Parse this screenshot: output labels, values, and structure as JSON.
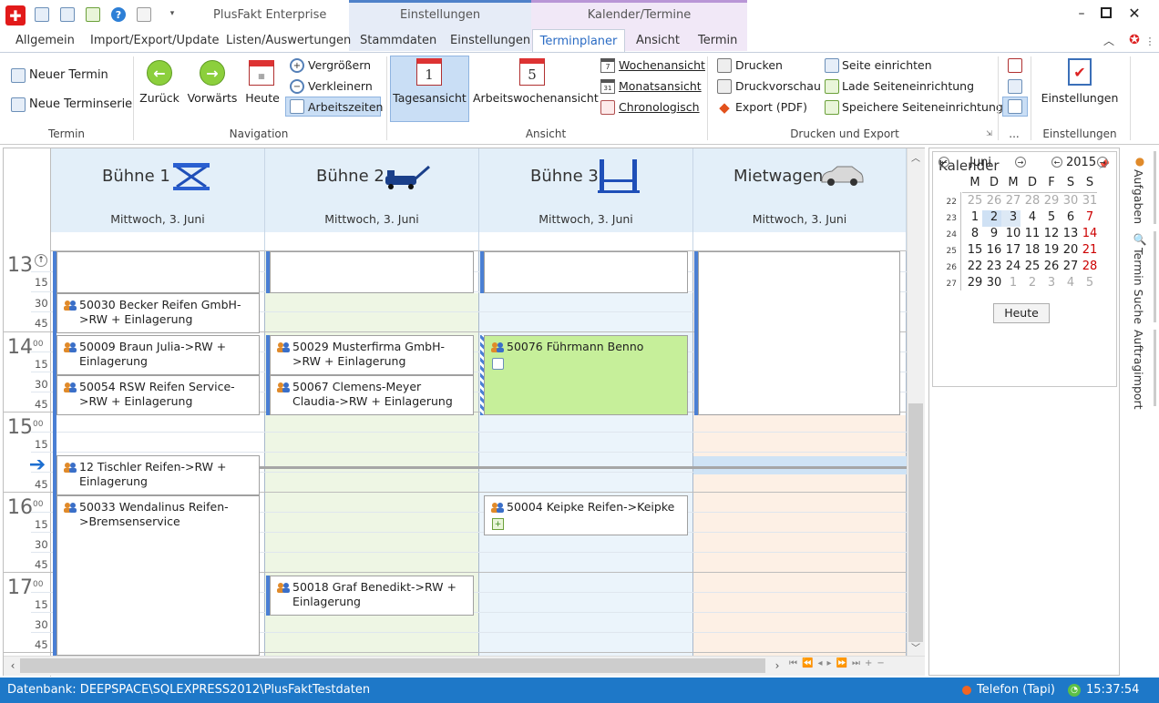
{
  "app_title": "PlusFakt Enterprise",
  "context_groups": [
    "Einstellungen",
    "Kalender/Termine"
  ],
  "ribbon_tabs": [
    "Allgemein",
    "Import/Export/Update",
    "Listen/Auswertungen",
    "Stammdaten",
    "Einstellungen",
    "Terminplaner",
    "Ansicht",
    "Termin"
  ],
  "active_tab": "Terminplaner",
  "ribbon": {
    "termin": {
      "new_appt": "Neuer Termin",
      "new_series": "Neue Terminserie",
      "label": "Termin"
    },
    "navigation": {
      "back": "Zurück",
      "forward": "Vorwärts",
      "today": "Heute",
      "zoom_in": "Vergrößern",
      "zoom_out": "Verkleinern",
      "worktime": "Arbeitszeiten",
      "label": "Navigation"
    },
    "ansicht": {
      "day_view": "Tagesansicht",
      "day_icon": "1",
      "workweek_view": "Arbeitswochenansicht",
      "workweek_icon": "5",
      "week": "Wochenansicht",
      "week_icon": "7",
      "month": "Monatsansicht",
      "month_icon": "31",
      "chrono": "Chronologisch",
      "label": "Ansicht"
    },
    "drucken": {
      "print": "Drucken",
      "preview": "Druckvorschau",
      "export_pdf": "Export (PDF)",
      "page_setup": "Seite einrichten",
      "load_setup": "Lade Seiteneinrichtung",
      "save_setup": "Speichere Seiteneinrichtung",
      "label": "Drucken und Export"
    },
    "more": {
      "label": "..."
    },
    "einstellungen": {
      "settings": "Einstellungen",
      "label": "Einstellungen"
    }
  },
  "columns": [
    {
      "name": "Bühne 1",
      "date": "Mittwoch, 3. Juni",
      "icon": "scissor-lift-icon"
    },
    {
      "name": "Bühne 2",
      "date": "Mittwoch, 3. Juni",
      "icon": "floor-jack-icon"
    },
    {
      "name": "Bühne 3",
      "date": "Mittwoch, 3. Juni",
      "icon": "two-post-lift-icon"
    },
    {
      "name": "Mietwagen",
      "date": "Mittwoch, 3. Juni",
      "icon": "car-icon"
    }
  ],
  "time_scale": {
    "hours": [
      {
        "h": "13",
        "m": "00"
      },
      {
        "h": "14",
        "m": "00"
      },
      {
        "h": "15",
        "m": "00"
      },
      {
        "h": "16",
        "m": "00"
      },
      {
        "h": "17",
        "m": "00"
      }
    ],
    "quarters": [
      "15",
      "30",
      "45"
    ]
  },
  "appointments": [
    {
      "text": "50030 Becker Reifen GmbH->RW + Einlagerung"
    },
    {
      "text": "50009 Braun Julia->RW + Einlagerung"
    },
    {
      "text": "50054 RSW Reifen Service->RW + Einlagerung"
    },
    {
      "text": "12 Tischler Reifen->RW + Einlagerung"
    },
    {
      "text": "50033 Wendalinus Reifen->Bremsenservice"
    },
    {
      "text": "50029 Musterfirma GmbH->RW + Einlagerung"
    },
    {
      "text": "50067 Clemens-Meyer Claudia->RW + Einlagerung"
    },
    {
      "text": "50018 Graf Benedikt->RW + Einlagerung"
    },
    {
      "text": "50076 Führmann Benno"
    },
    {
      "text": "50004 Keipke Reifen->Keipke"
    }
  ],
  "calendar": {
    "title": "Kalender",
    "month": "Juni",
    "year": "2015",
    "weekdays": [
      "M",
      "D",
      "M",
      "D",
      "F",
      "S",
      "S"
    ],
    "weeks": [
      {
        "wk": "22",
        "days": [
          "25",
          "26",
          "27",
          "28",
          "29",
          "30",
          "31"
        ]
      },
      {
        "wk": "23",
        "days": [
          "1",
          "2",
          "3",
          "4",
          "5",
          "6",
          "7"
        ]
      },
      {
        "wk": "24",
        "days": [
          "8",
          "9",
          "10",
          "11",
          "12",
          "13",
          "14"
        ]
      },
      {
        "wk": "25",
        "days": [
          "15",
          "16",
          "17",
          "18",
          "19",
          "20",
          "21"
        ]
      },
      {
        "wk": "26",
        "days": [
          "22",
          "23",
          "24",
          "25",
          "26",
          "27",
          "28"
        ]
      },
      {
        "wk": "27",
        "days": [
          "29",
          "30",
          "1",
          "2",
          "3",
          "4",
          "5"
        ]
      }
    ],
    "today_button": "Heute"
  },
  "side_tabs": [
    "Aufgaben",
    "Termin Suche",
    "Auftragimport"
  ],
  "status": {
    "db": "Datenbank: DEEPSPACE\\SQLEXPRESS2012\\PlusFaktTestdaten",
    "phone": "Telefon (Tapi)",
    "time": "15:37:54"
  },
  "colors": {
    "accent": "#1e78c8",
    "green_appt": "#c6ef9a",
    "bar_blue": "#4a7fd4"
  }
}
